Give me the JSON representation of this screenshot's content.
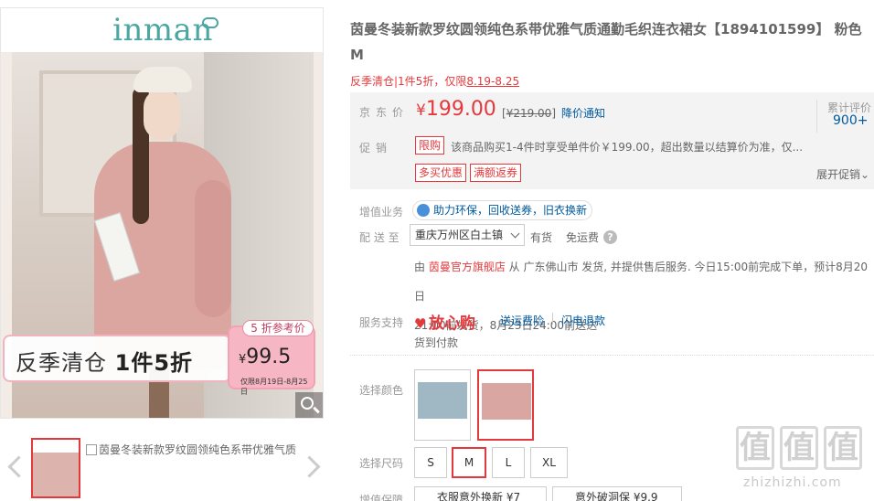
{
  "gallery": {
    "brand": "inman",
    "promo": {
      "tag": "5 折参考价",
      "headline_prefix": "反季清仓 ",
      "headline_bold": "1件5折",
      "currency": "¥",
      "price": "99.5",
      "date_range": "仅限8月19日-8月25日"
    },
    "thumb_broken_alt": "茵曼冬装新款罗纹圆领纯色系带优雅气质"
  },
  "product": {
    "title": "茵曼冬装新款罗纹圆领纯色系带优雅气质通勤毛织连衣裙女【1894101599】 粉色 M",
    "subtitle_prefix": "反季清仓|1件5折，仅限",
    "subtitle_date": "8.19-8.25",
    "price_label": "京东价",
    "currency": "¥",
    "price": "199.00",
    "orig_open": "[",
    "orig_price": "¥219.00",
    "orig_close": "]",
    "notify_label": "降价通知",
    "review_label": "累计评价",
    "review_count": "900+",
    "promo_label": "促销",
    "promo_tags": [
      "限购",
      "多买优惠",
      "满额返券"
    ],
    "promo_desc": "该商品购买1-4件时享受单件价￥199.00，超出数量以结算价为准，仅...",
    "expand_label": "展开促销",
    "expand_arrow": "⌄"
  },
  "services": {
    "label_value_added": "增值业务",
    "chip_text": "助力环保，回收送券，旧衣换新",
    "label_ship_to": "配 送 至",
    "address": "重庆万州区白土镇",
    "stock": "有货",
    "free_shipping": "免运费",
    "help_glyph": "?",
    "ship_line1_prefix": "由 ",
    "ship_shop": "茵曼官方旗舰店",
    "ship_line1_rest": " 从 广东佛山市 发货, 并提供售后服务. 今日15:00前完成下单，预计8月20日",
    "ship_line2": "21:00前发货，8月23日24:00前送达",
    "label_support": "服务支持",
    "fangxin_glyph": "♥",
    "fangxin": "放心购",
    "svc1": "送运费险",
    "svc2": "闪电退款",
    "cod": "货到付款"
  },
  "selection": {
    "label_color": "选择颜色",
    "label_size": "选择尺码",
    "sizes": [
      "S",
      "M",
      "L",
      "XL"
    ],
    "selected_size": "M",
    "label_warranty": "增值保障",
    "warranty1": "衣服意外换新 ¥7",
    "warranty2": "意外破洞保 ¥9.9"
  },
  "watermark": {
    "glyph": "值",
    "text": "zhizhizhi.com"
  },
  "colors": {
    "accent": "#e4393c",
    "link": "#005aa0",
    "brand": "#4aa7a3"
  }
}
